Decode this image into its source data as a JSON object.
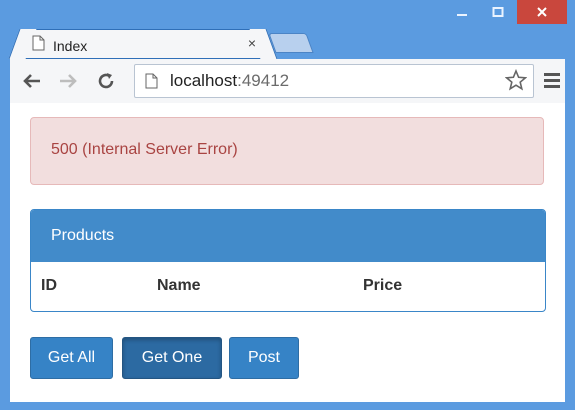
{
  "window": {
    "controls": {
      "minimize_icon": "minimize-icon",
      "maximize_icon": "maximize-icon",
      "close_icon": "close-icon"
    }
  },
  "tab": {
    "title": "Index",
    "icon": "page-icon",
    "close": "×"
  },
  "toolbar": {
    "url_host": "localhost",
    "url_port": ":49412",
    "back_icon": "back-arrow-icon",
    "forward_icon": "forward-arrow-icon",
    "reload_icon": "reload-icon",
    "star_icon": "star-icon",
    "menu_icon": "menu-icon"
  },
  "alert": {
    "text": "500 (Internal Server Error)",
    "color": "#a94442"
  },
  "panel": {
    "heading": "Products",
    "columns": [
      "ID",
      "Name",
      "Price"
    ]
  },
  "buttons": [
    {
      "label": "Get All",
      "active": false
    },
    {
      "label": "Get One",
      "active": true
    },
    {
      "label": "Post",
      "active": false
    }
  ],
  "colors": {
    "primary": "#428bca",
    "chrome": "#5b9be0",
    "alert_bg": "#f2dede"
  }
}
